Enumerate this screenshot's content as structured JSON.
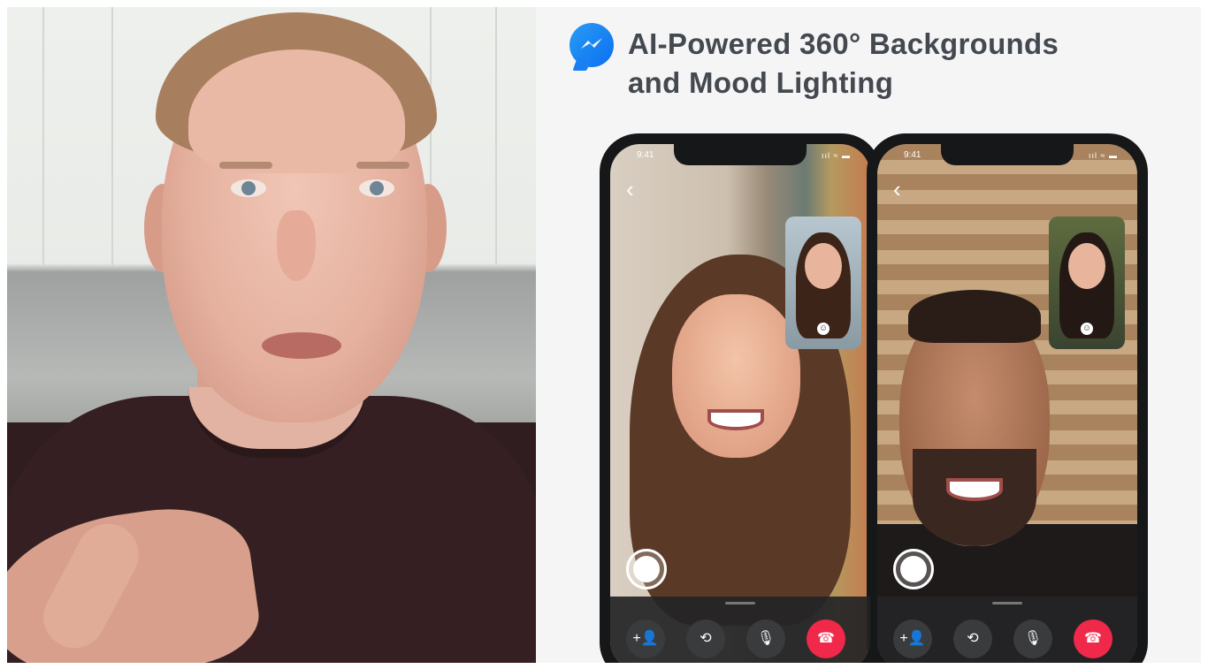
{
  "slide": {
    "title_line1": "AI-Powered 360° Backgrounds",
    "title_line2": "and Mood Lighting",
    "logo_icon": "messenger-icon"
  },
  "phones": [
    {
      "time": "9:41",
      "status": "ııl ≈ ▬",
      "back_icon": "‹",
      "controls": [
        {
          "icon": "add-person-icon",
          "glyph": "+👤"
        },
        {
          "icon": "flip-camera-icon",
          "glyph": "⟲"
        },
        {
          "icon": "microphone-icon",
          "glyph": "🎙"
        },
        {
          "icon": "end-call-icon",
          "glyph": "☎"
        }
      ]
    },
    {
      "time": "9:41",
      "status": "ııl ≈ ▬",
      "back_icon": "‹",
      "controls": [
        {
          "icon": "add-person-icon",
          "glyph": "+👤"
        },
        {
          "icon": "flip-camera-icon",
          "glyph": "⟲"
        },
        {
          "icon": "microphone-icon",
          "glyph": "🎙"
        },
        {
          "icon": "end-call-icon",
          "glyph": "☎"
        }
      ]
    }
  ],
  "colors": {
    "end_call": "#f02849",
    "messenger_blue": "#0a7cff",
    "title_text": "#444950"
  }
}
